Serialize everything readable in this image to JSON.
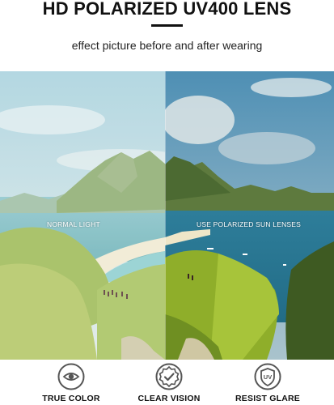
{
  "header": {
    "title": "HD POLARIZED UV400 LENS",
    "subtitle": "effect picture before and after wearing"
  },
  "comparison": {
    "left_label": "NORMAL LIGHT",
    "right_label": "USE POLARIZED SUN LENSES"
  },
  "features": [
    {
      "label": "TRUE COLOR",
      "icon": "eye-icon"
    },
    {
      "label": "CLEAR VISION",
      "icon": "badge-check-icon"
    },
    {
      "label": "RESIST GLARE",
      "icon": "uv-shield-icon"
    }
  ]
}
